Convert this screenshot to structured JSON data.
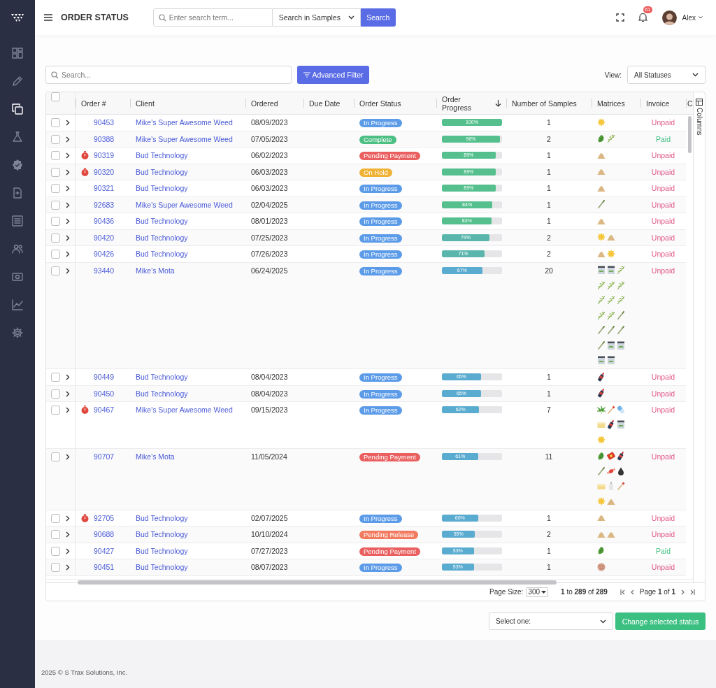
{
  "sidebar": {
    "items": [
      {
        "kind": "grid",
        "selected": false
      },
      {
        "kind": "pen",
        "selected": false
      },
      {
        "kind": "copy",
        "selected": true
      },
      {
        "kind": "flask",
        "selected": false
      },
      {
        "kind": "seal",
        "selected": false
      },
      {
        "kind": "file",
        "selected": false
      },
      {
        "kind": "list",
        "selected": false
      },
      {
        "kind": "users",
        "selected": false
      },
      {
        "kind": "cash",
        "selected": false
      },
      {
        "kind": "chart",
        "selected": false
      },
      {
        "kind": "gear",
        "selected": false
      }
    ]
  },
  "header": {
    "title": "ORDER STATUS",
    "search": {
      "placeholder": "Enter search term...",
      "scope": "Search in Samples",
      "button": "Search"
    },
    "notifications": "61",
    "user": "Alex"
  },
  "toolbar": {
    "search_placeholder": "Search...",
    "filter_button": "Advanced Filter",
    "view_label": "View:",
    "view_value": "All Statuses"
  },
  "table": {
    "select_all": {
      "checked": false
    },
    "columns": [
      {
        "label": "Order #",
        "sorted": false
      },
      {
        "label": "Client",
        "sorted": false
      },
      {
        "label": "Ordered",
        "sorted": false
      },
      {
        "label": "Due Date",
        "sorted": false
      },
      {
        "label": "Order Status",
        "sorted": false
      },
      {
        "label": "Order Progress",
        "sorted": true
      },
      {
        "label": "Number of Samples",
        "sorted": false
      },
      {
        "label": "Matrices",
        "sorted": false
      },
      {
        "label": "Invoice",
        "sorted": false
      },
      {
        "label": "C",
        "sorted": false
      }
    ],
    "rows": [
      {
        "checked": false,
        "timer": false,
        "order": "90453",
        "client": "Mike's Super Awesome Weed",
        "ordered": "08/09/2023",
        "status": {
          "label": "In Progress",
          "color": "#5b9be8"
        },
        "progress": {
          "level": 1.0,
          "label": "100%"
        },
        "samples": "1",
        "matrices": [
          {
            "kind": "burst"
          }
        ],
        "invoice": {
          "label": "Unpaid",
          "paid": false
        }
      },
      {
        "checked": false,
        "timer": false,
        "order": "90388",
        "client": "Mike's Super Awesome Weed",
        "ordered": "07/05/2023",
        "status": {
          "label": "Complete",
          "color": "#4cbf83"
        },
        "progress": {
          "level": 0.96,
          "label": "96%"
        },
        "samples": "2",
        "matrices": [
          {
            "kind": "bud"
          },
          {
            "kind": "sprig"
          }
        ],
        "invoice": {
          "label": "Paid",
          "paid": true
        }
      },
      {
        "checked": false,
        "timer": true,
        "order": "90319",
        "client": "Bud Technology",
        "ordered": "06/02/2023",
        "status": {
          "label": "Pending Payment",
          "color": "#ea5f5f"
        },
        "progress": {
          "level": 0.89,
          "label": "89%"
        },
        "samples": "1",
        "matrices": [
          {
            "kind": "mound"
          }
        ],
        "invoice": {
          "label": "Unpaid",
          "paid": false
        }
      },
      {
        "checked": false,
        "timer": true,
        "order": "90320",
        "client": "Bud Technology",
        "ordered": "06/03/2023",
        "status": {
          "label": "On Hold",
          "color": "#f0b234"
        },
        "progress": {
          "level": 0.89,
          "label": "89%"
        },
        "samples": "1",
        "matrices": [
          {
            "kind": "mound"
          }
        ],
        "invoice": {
          "label": "Unpaid",
          "paid": false
        }
      },
      {
        "checked": false,
        "timer": false,
        "order": "90321",
        "client": "Bud Technology",
        "ordered": "06/03/2023",
        "status": {
          "label": "In Progress",
          "color": "#5b9be8"
        },
        "progress": {
          "level": 0.89,
          "label": "89%"
        },
        "samples": "1",
        "matrices": [
          {
            "kind": "mound"
          }
        ],
        "invoice": {
          "label": "Unpaid",
          "paid": false
        }
      },
      {
        "checked": false,
        "timer": false,
        "order": "92683",
        "client": "Mike's Super Awesome Weed",
        "ordered": "02/04/2025",
        "status": {
          "label": "In Progress",
          "color": "#5b9be8"
        },
        "progress": {
          "level": 0.84,
          "label": "84%"
        },
        "samples": "1",
        "matrices": [
          {
            "kind": "stick"
          }
        ],
        "invoice": {
          "label": "Unpaid",
          "paid": false
        }
      },
      {
        "checked": false,
        "timer": false,
        "order": "90436",
        "client": "Bud Technology",
        "ordered": "08/01/2023",
        "status": {
          "label": "In Progress",
          "color": "#5b9be8"
        },
        "progress": {
          "level": 0.83,
          "label": "83%"
        },
        "samples": "1",
        "matrices": [
          {
            "kind": "mound"
          }
        ],
        "invoice": {
          "label": "Unpaid",
          "paid": false
        }
      },
      {
        "checked": false,
        "timer": false,
        "order": "90420",
        "client": "Bud Technology",
        "ordered": "07/25/2023",
        "status": {
          "label": "In Progress",
          "color": "#5b9be8"
        },
        "progress": {
          "level": 0.79,
          "label": "79%"
        },
        "samples": "2",
        "matrices": [
          {
            "kind": "burst"
          },
          {
            "kind": "mound"
          }
        ],
        "invoice": {
          "label": "Unpaid",
          "paid": false
        }
      },
      {
        "checked": false,
        "timer": false,
        "order": "90426",
        "client": "Bud Technology",
        "ordered": "07/26/2023",
        "status": {
          "label": "In Progress",
          "color": "#5b9be8"
        },
        "progress": {
          "level": 0.71,
          "label": "71%"
        },
        "samples": "2",
        "matrices": [
          {
            "kind": "mound"
          },
          {
            "kind": "burst"
          }
        ],
        "invoice": {
          "label": "Unpaid",
          "paid": false
        }
      },
      {
        "checked": false,
        "timer": false,
        "order": "93440",
        "client": "Mike's Mota",
        "ordered": "06/24/2025",
        "status": {
          "label": "In Progress",
          "color": "#5b9be8"
        },
        "progress": {
          "level": 0.67,
          "label": "67%"
        },
        "samples": "20",
        "matrices": [
          {
            "kind": "jar"
          },
          {
            "kind": "jar"
          },
          {
            "kind": "sprig"
          },
          {
            "kind": "sprig"
          },
          {
            "kind": "sprig"
          },
          {
            "kind": "sprig"
          },
          {
            "kind": "sprig"
          },
          {
            "kind": "sprig"
          },
          {
            "kind": "sprig"
          },
          {
            "kind": "sprig"
          },
          {
            "kind": "sprig"
          },
          {
            "kind": "stick"
          },
          {
            "kind": "stick"
          },
          {
            "kind": "stick"
          },
          {
            "kind": "stick"
          },
          {
            "kind": "stick"
          },
          {
            "kind": "jar"
          },
          {
            "kind": "jar"
          },
          {
            "kind": "jar"
          },
          {
            "kind": "jar"
          }
        ],
        "invoice": {
          "label": "Unpaid",
          "paid": false
        }
      },
      {
        "checked": false,
        "timer": false,
        "order": "90449",
        "client": "Bud Technology",
        "ordered": "08/04/2023",
        "status": {
          "label": "In Progress",
          "color": "#5b9be8"
        },
        "progress": {
          "level": 0.65,
          "label": "65%"
        },
        "samples": "1",
        "matrices": [
          {
            "kind": "bottle"
          }
        ],
        "invoice": {
          "label": "Unpaid",
          "paid": false
        }
      },
      {
        "checked": false,
        "timer": false,
        "order": "90450",
        "client": "Bud Technology",
        "ordered": "08/04/2023",
        "status": {
          "label": "In Progress",
          "color": "#5b9be8"
        },
        "progress": {
          "level": 0.65,
          "label": "65%"
        },
        "samples": "1",
        "matrices": [
          {
            "kind": "bottle"
          }
        ],
        "invoice": {
          "label": "Unpaid",
          "paid": false
        }
      },
      {
        "checked": false,
        "timer": true,
        "order": "90467",
        "client": "Mike's Super Awesome Weed",
        "ordered": "09/15/2023",
        "status": {
          "label": "In Progress",
          "color": "#5b9be8"
        },
        "progress": {
          "level": 0.62,
          "label": "62%"
        },
        "samples": "7",
        "matrices": [
          {
            "kind": "leaf"
          },
          {
            "kind": "dropper"
          },
          {
            "kind": "capsule"
          },
          {
            "kind": "tub"
          },
          {
            "kind": "bottle"
          },
          {
            "kind": "jar"
          },
          {
            "kind": "burst"
          }
        ],
        "invoice": {
          "label": "Unpaid",
          "paid": false
        }
      },
      {
        "checked": false,
        "timer": false,
        "order": "90707",
        "client": "Mike's Mota",
        "ordered": "11/05/2024",
        "status": {
          "label": "Pending Payment",
          "color": "#ea5f5f"
        },
        "progress": {
          "level": 0.61,
          "label": "61%"
        },
        "samples": "11",
        "matrices": [
          {
            "kind": "bud"
          },
          {
            "kind": "bag"
          },
          {
            "kind": "bottle"
          },
          {
            "kind": "stick"
          },
          {
            "kind": "candy"
          },
          {
            "kind": "drop"
          },
          {
            "kind": "tub"
          },
          {
            "kind": "pump"
          },
          {
            "kind": "dropper"
          },
          {
            "kind": "burst"
          },
          {
            "kind": "mound"
          }
        ],
        "invoice": {
          "label": "Unpaid",
          "paid": false
        }
      },
      {
        "checked": false,
        "timer": true,
        "order": "92705",
        "client": "Bud Technology",
        "ordered": "02/07/2025",
        "status": {
          "label": "In Progress",
          "color": "#5b9be8"
        },
        "progress": {
          "level": 0.6,
          "label": "60%"
        },
        "samples": "1",
        "matrices": [
          {
            "kind": "mound"
          }
        ],
        "invoice": {
          "label": "Unpaid",
          "paid": false
        }
      },
      {
        "checked": false,
        "timer": false,
        "order": "90688",
        "client": "Bud Technology",
        "ordered": "10/10/2024",
        "status": {
          "label": "Pending Release",
          "color": "#f27a5e"
        },
        "progress": {
          "level": 0.55,
          "label": "55%"
        },
        "samples": "2",
        "matrices": [
          {
            "kind": "mound"
          },
          {
            "kind": "mound"
          }
        ],
        "invoice": {
          "label": "Unpaid",
          "paid": false
        }
      },
      {
        "checked": false,
        "timer": false,
        "order": "90427",
        "client": "Bud Technology",
        "ordered": "07/27/2023",
        "status": {
          "label": "Pending Payment",
          "color": "#ea5f5f"
        },
        "progress": {
          "level": 0.53,
          "label": "53%"
        },
        "samples": "1",
        "matrices": [
          {
            "kind": "bud"
          }
        ],
        "invoice": {
          "label": "Paid",
          "paid": true
        }
      },
      {
        "checked": false,
        "timer": false,
        "order": "90451",
        "client": "Bud Technology",
        "ordered": "08/07/2023",
        "status": {
          "label": "In Progress",
          "color": "#5b9be8"
        },
        "progress": {
          "level": 0.53,
          "label": "53%"
        },
        "samples": "1",
        "matrices": [
          {
            "kind": "cookie"
          }
        ],
        "invoice": {
          "label": "Unpaid",
          "paid": false
        }
      }
    ],
    "pagination": {
      "page_size_label": "Page Size:",
      "page_size": "300",
      "range": "**1** to **289** of **289**",
      "page": "Page **1** of **1**"
    }
  },
  "side_panel": {
    "label": "Columns"
  },
  "actions": {
    "select_value": "Select one:",
    "button": "Change selected status"
  },
  "footer": "2025 © S Trax Solutions, Inc."
}
